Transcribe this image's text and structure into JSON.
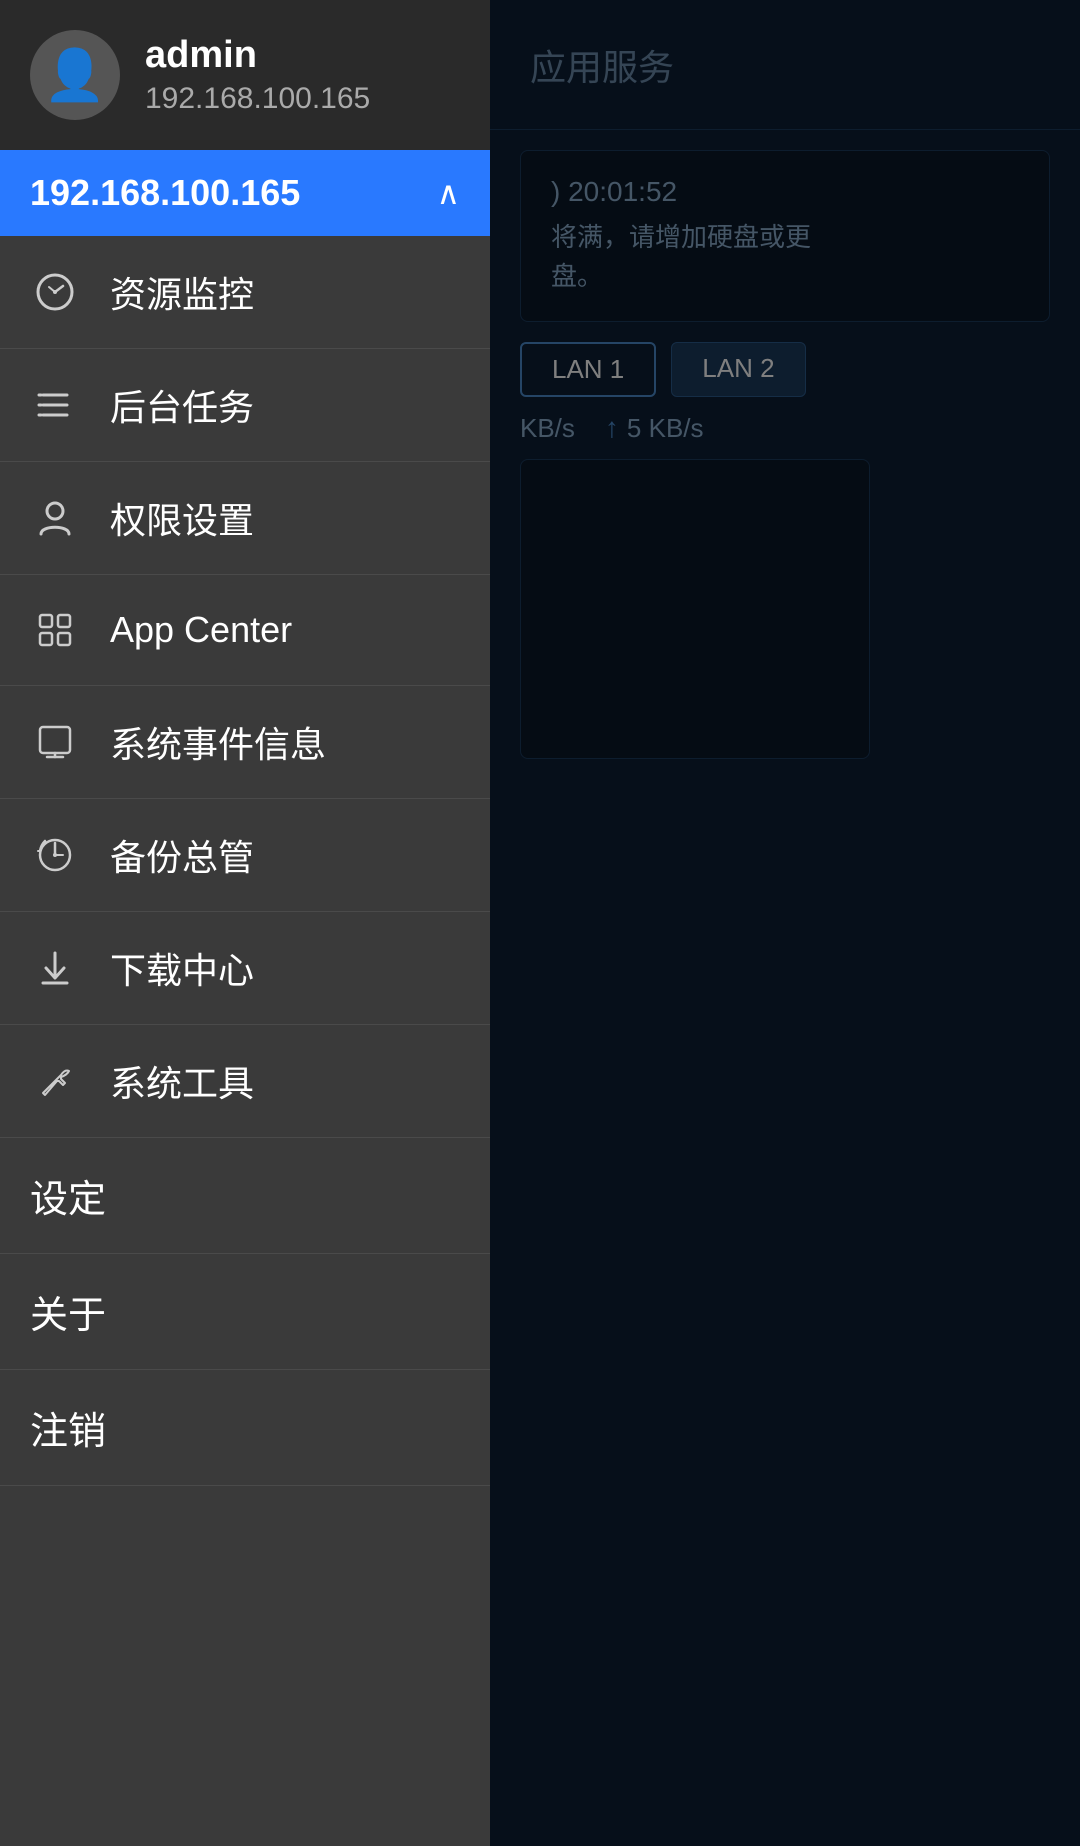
{
  "user": {
    "name": "admin",
    "ip": "192.168.100.165",
    "avatar_icon": "👤"
  },
  "server_selector": {
    "ip": "192.168.100.165",
    "chevron": "∧"
  },
  "right_panel": {
    "title": "应用服务",
    "notification": {
      "time": ") 20:01:52",
      "text": "将满，请增加硬盘或更\n盘。"
    },
    "lan_tabs": [
      {
        "label": "LAN 1",
        "active": true
      },
      {
        "label": "LAN 2",
        "active": false
      }
    ],
    "speeds": {
      "download": "KB/s",
      "upload": "5 KB/s",
      "up_arrow": "↑"
    }
  },
  "menu": {
    "items": [
      {
        "id": "resource-monitor",
        "icon": "⏱",
        "label": "资源监控"
      },
      {
        "id": "background-tasks",
        "icon": "≡",
        "label": "后台任务"
      },
      {
        "id": "permissions",
        "icon": "♟",
        "label": "权限设置"
      },
      {
        "id": "app-center",
        "icon": "⊞",
        "label": "App Center"
      },
      {
        "id": "system-events",
        "icon": "⊡",
        "label": "系统事件信息"
      },
      {
        "id": "backup",
        "icon": "⏰",
        "label": "备份总管"
      },
      {
        "id": "download-center",
        "icon": "↓",
        "label": "下载中心"
      },
      {
        "id": "system-tools",
        "icon": "🔧",
        "label": "系统工具"
      }
    ],
    "sections": [
      {
        "id": "settings",
        "label": "设定"
      },
      {
        "id": "about",
        "label": "关于"
      },
      {
        "id": "logout",
        "label": "注销"
      }
    ]
  }
}
